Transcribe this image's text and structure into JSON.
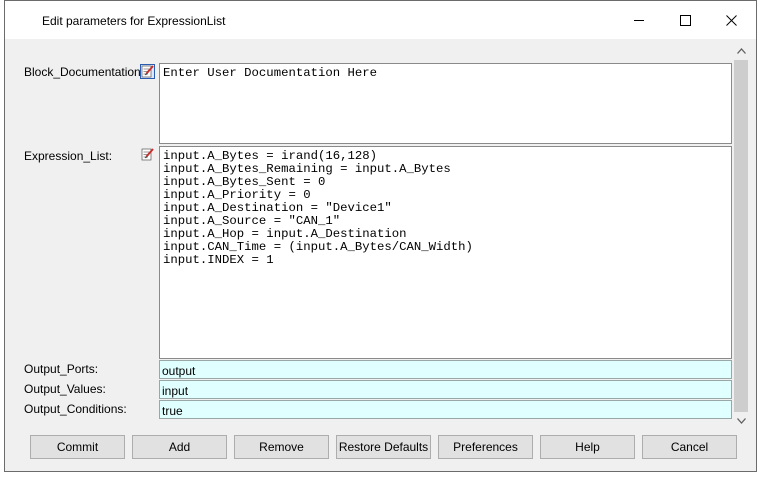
{
  "window": {
    "title": "Edit parameters for ExpressionList"
  },
  "form": {
    "block_documentation": {
      "label": "Block_Documentation:",
      "value": "Enter User Documentation Here"
    },
    "expression_list": {
      "label": "Expression_List:",
      "lines": [
        "input.A_Bytes = irand(16,128)",
        "input.A_Bytes_Remaining = input.A_Bytes",
        "input.A_Bytes_Sent = 0",
        "input.A_Priority = 0",
        "input.A_Destination = \"Device1\"",
        "input.A_Source = \"CAN_1\"",
        "input.A_Hop = input.A_Destination",
        "input.CAN_Time = (input.A_Bytes/CAN_Width)",
        "input.INDEX = 1"
      ]
    },
    "output_ports": {
      "label": "Output_Ports:",
      "value": "output"
    },
    "output_values": {
      "label": "Output_Values:",
      "value": "input"
    },
    "output_conditions": {
      "label": "Output_Conditions:",
      "value": "true"
    }
  },
  "buttons": {
    "commit": "Commit",
    "add": "Add",
    "remove": "Remove",
    "restore_defaults": "Restore Defaults",
    "preferences": "Preferences",
    "help": "Help",
    "cancel": "Cancel"
  },
  "colors": {
    "field_bg": "#e0ffff",
    "window_bg": "#f0f0f0",
    "button_bg": "#e1e1e1"
  },
  "icons": {
    "edit": "edit-pencil-icon",
    "minimize": "minimize-icon",
    "maximize": "maximize-icon",
    "close": "close-icon",
    "scroll_up": "chevron-up-icon",
    "scroll_down": "chevron-down-icon"
  }
}
